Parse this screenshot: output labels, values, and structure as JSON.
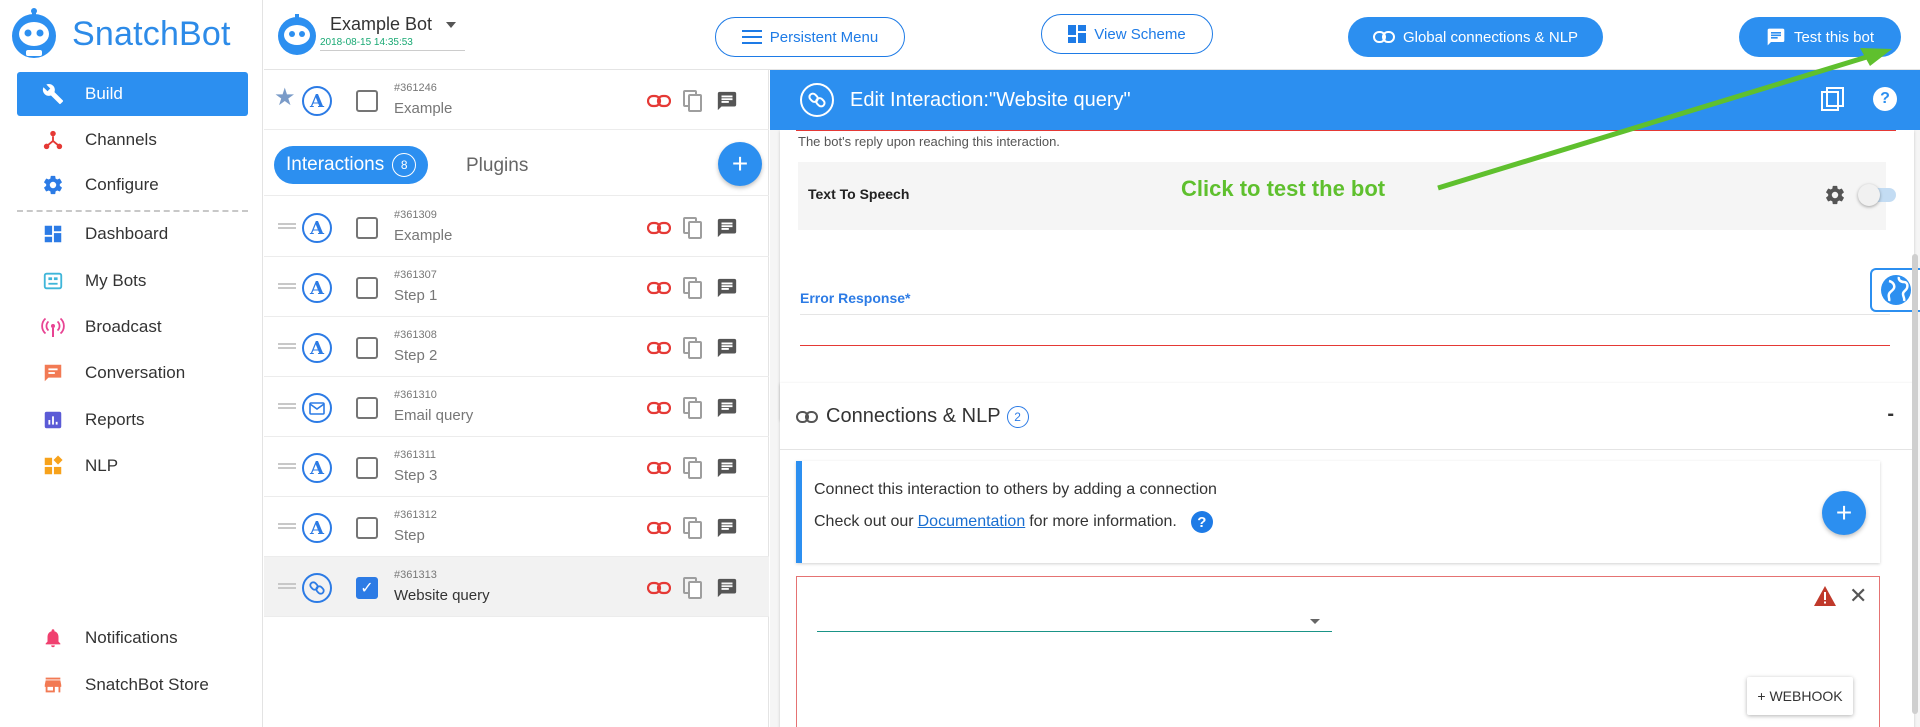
{
  "brand": {
    "name": "SnatchBot"
  },
  "sidebar": {
    "items": [
      {
        "label": "Build",
        "icon": "wrench-icon",
        "active": true
      },
      {
        "label": "Channels",
        "icon": "channels-icon"
      },
      {
        "label": "Configure",
        "icon": "gear-icon"
      },
      {
        "label": "Dashboard",
        "icon": "dashboard-icon"
      },
      {
        "label": "My Bots",
        "icon": "bots-icon"
      },
      {
        "label": "Broadcast",
        "icon": "broadcast-icon"
      },
      {
        "label": "Conversation",
        "icon": "conversation-icon"
      },
      {
        "label": "Reports",
        "icon": "reports-icon"
      },
      {
        "label": "NLP",
        "icon": "nlp-icon"
      },
      {
        "label": "Notifications",
        "icon": "bell-icon"
      },
      {
        "label": "SnatchBot Store",
        "icon": "store-icon"
      }
    ]
  },
  "topbar": {
    "bot_name": "Example Bot",
    "bot_date": "2018-08-15 14:35:53",
    "persistent_menu": "Persistent Menu",
    "view_scheme": "View Scheme",
    "global_connections": "Global connections & NLP",
    "test_bot": "Test this bot"
  },
  "interactions": {
    "pinned": {
      "id": "#361246",
      "name": "Example"
    },
    "tab_interactions": "Interactions",
    "tab_count": "8",
    "tab_plugins": "Plugins",
    "rows": [
      {
        "id": "#361309",
        "name": "Example",
        "type": "text"
      },
      {
        "id": "#361307",
        "name": "Step 1",
        "type": "text"
      },
      {
        "id": "#361308",
        "name": "Step 2",
        "type": "text"
      },
      {
        "id": "#361310",
        "name": "Email query",
        "type": "email"
      },
      {
        "id": "#361311",
        "name": "Step 3",
        "type": "text"
      },
      {
        "id": "#361312",
        "name": "Step",
        "type": "text"
      },
      {
        "id": "#361313",
        "name": "Website query",
        "type": "link",
        "selected": true
      }
    ]
  },
  "editor": {
    "title": "Edit Interaction:\"Website query\"",
    "reply_hint": "The bot's reply upon reaching this interaction.",
    "tts_label": "Text To Speech",
    "annotation": "Click to test the bot",
    "error_response_label": "Error Response*",
    "connections_title": "Connections & NLP",
    "connections_count": "2",
    "collapse": "-",
    "info_line1": "Connect this interaction to others by adding a connection",
    "info_prefix": "Check out our",
    "info_link": "Documentation",
    "info_suffix": "for more information.",
    "webhook_button": "+ WEBHOOK"
  },
  "colors": {
    "primary": "#2c8ff0",
    "annotation_green": "#5fc02e",
    "error_red": "#e53935"
  }
}
